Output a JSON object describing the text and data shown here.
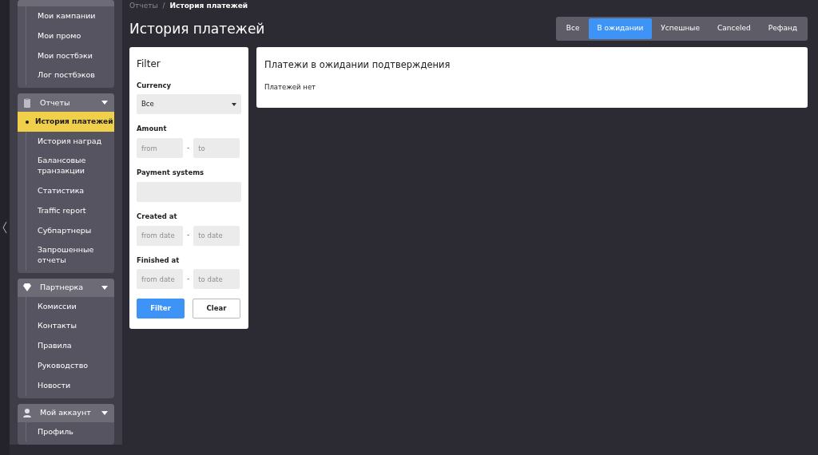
{
  "sidebar": {
    "groups": [
      {
        "items": [
          {
            "label": "Мои кампании",
            "selected": false
          },
          {
            "label": "Мои промо",
            "selected": false
          },
          {
            "label": "Мои постбэки",
            "selected": false
          },
          {
            "label": "Лог постбэков",
            "selected": false
          }
        ]
      },
      {
        "title": "Отчеты",
        "items": [
          {
            "label": "История платежей",
            "selected": true
          },
          {
            "label": "История наград",
            "selected": false
          },
          {
            "label": "Балансовые транзакции",
            "selected": false
          },
          {
            "label": "Статистика",
            "selected": false
          },
          {
            "label": "Traffic report",
            "selected": false
          },
          {
            "label": "Субпартнеры",
            "selected": false
          },
          {
            "label": "Запрошенные отчеты",
            "selected": false
          }
        ]
      },
      {
        "title": "Партнерка",
        "items": [
          {
            "label": "Комиссии",
            "selected": false
          },
          {
            "label": "Контакты",
            "selected": false
          },
          {
            "label": "Правила",
            "selected": false
          },
          {
            "label": "Руководство",
            "selected": false
          },
          {
            "label": "Новости",
            "selected": false
          }
        ]
      },
      {
        "title": "Мой аккаунт",
        "items": [
          {
            "label": "Профиль",
            "selected": false
          }
        ]
      }
    ]
  },
  "breadcrumb": [
    "Отчеты",
    "История платежей"
  ],
  "breadcrumb_separator": "/",
  "page_title": "История платежей",
  "tabs": [
    {
      "label": "Все",
      "selected": false
    },
    {
      "label": "В ожидании",
      "selected": true
    },
    {
      "label": "Успешные",
      "selected": false
    },
    {
      "label": "Canceled",
      "selected": false
    },
    {
      "label": "Рефанд",
      "selected": false
    }
  ],
  "filter": {
    "title": "Filter",
    "fields": [
      {
        "kind": "select",
        "label": "Currency",
        "value": "Все"
      },
      {
        "kind": "range",
        "label": "Amount",
        "placeholders": [
          "from",
          "to"
        ],
        "separator": "-"
      },
      {
        "kind": "text",
        "label": "Payment systems"
      },
      {
        "kind": "range",
        "label": "Created at",
        "placeholders": [
          "from date",
          "to date"
        ],
        "separator": "-"
      },
      {
        "kind": "range",
        "label": "Finished at",
        "placeholders": [
          "from date",
          "to date"
        ],
        "separator": "-"
      }
    ],
    "buttons": [
      {
        "label": "Filter",
        "primary": true
      },
      {
        "label": "Clear",
        "primary": false
      }
    ]
  },
  "panel": {
    "title": "Платежи в ожидании подтверждения",
    "message": "Платежей нет"
  }
}
